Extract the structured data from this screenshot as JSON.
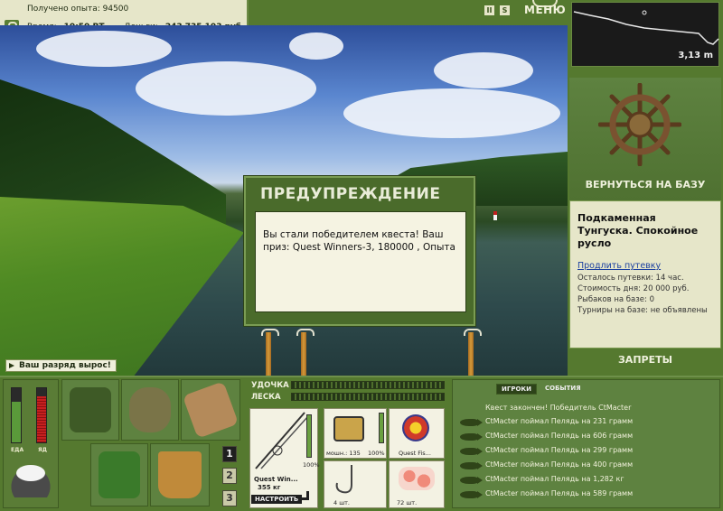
{
  "status": {
    "exp_label": "Получено опыта:",
    "exp_value": "94500",
    "time_label": "Время:",
    "time_value": "10:50 ВТ",
    "money_label": "Деньги:",
    "money_value": "243 735 103 руб."
  },
  "header": {
    "menu_label": "МЕНЮ",
    "pause_icon": "pause-icon",
    "sound_icon": "sound-icon"
  },
  "scene": {
    "rank_up_text": "Ваш разряд вырос!"
  },
  "dialog": {
    "title": "ПРЕДУПРЕЖДЕНИЕ",
    "message": "Вы стали победителем квеста! Ваш приз: Quest Winners-3, 180000 , Опыта"
  },
  "depth_map": {
    "depth": "3,13 m"
  },
  "base": {
    "return_label": "ВЕРНУТЬСЯ НА БАЗУ",
    "place_name": "Подкаменная Тунгуска. Спокойное русло",
    "extend_link": "Продлить путевку",
    "lines": [
      "Осталось путевки: 14 час.",
      "Стоимость дня: 20 000 руб.",
      "Рыбаков на базе: 0",
      "Турниры на базе: не объявлены"
    ],
    "bans_label": "ЗАПРЕТЫ"
  },
  "meters": {
    "food_label": "ЕДА",
    "poison_label": "ЯД",
    "food_level": 0.75,
    "poison_level": 0.85
  },
  "inventory": {
    "pages": [
      "1",
      "2",
      "3"
    ],
    "active_page": "1"
  },
  "tackle": {
    "rod_label": "УДОЧКА",
    "line_label": "ЛЕСКА",
    "rod_name": "Quest Win...",
    "rod_weight": "355 кг",
    "rod_percent": "100%",
    "reel_caption": "мошн.: 135",
    "reel_percent": "100%",
    "lure_caption": "Quest Fis...",
    "hook_caption": "4 шт.",
    "bait_caption": "72 шт.",
    "setup_label": "НАСТРОИТЬ"
  },
  "events": {
    "tabs": [
      "ИГРОКИ",
      "СОБЫТИЯ"
    ],
    "headline": "Квест закончен! Победитель CtMacter",
    "rows": [
      "CtMacter поймал Пелядь на 231 грамм",
      "CtMacter поймал Пелядь на 606 грамм",
      "CtMacter поймал Пелядь на 299 грамм",
      "CtMacter поймал Пелядь на 400 грамм",
      "CtMacter поймал Пелядь на 1,282 кг",
      "CtMacter поймал Пелядь на 589 грамм"
    ]
  },
  "colors": {
    "panel_green": "#55792f",
    "cream": "#e6e6c9",
    "dark": "#1f2b12"
  }
}
